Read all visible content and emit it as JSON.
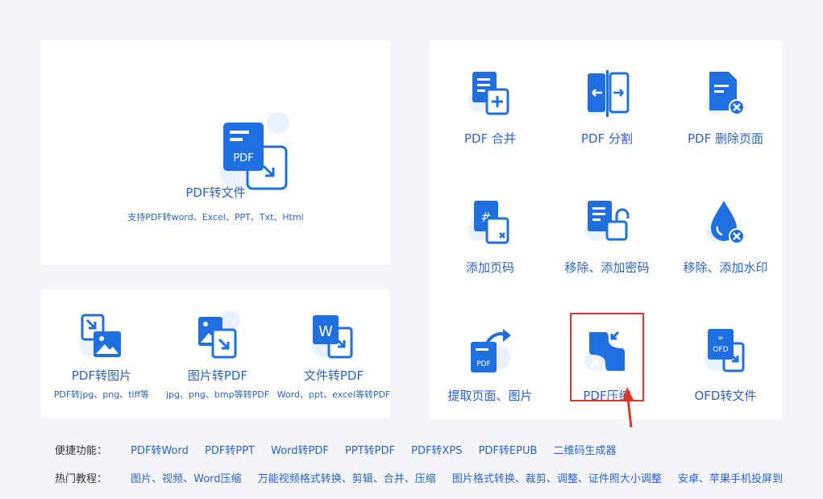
{
  "main_card": {
    "title": "PDF转文件",
    "subtitle": "支持PDF转word、Excel、PPT、Txt、Html",
    "icon": "pdf-to-file-icon",
    "icon_text": "PDF"
  },
  "conversions": [
    {
      "label": "PDF转图片",
      "desc": "PDF转jpg、png、tiff等",
      "icon": "pdf-to-image-icon"
    },
    {
      "label": "图片转PDF",
      "desc": "jpg、png、bmp等转PDF",
      "icon": "image-to-pdf-icon"
    },
    {
      "label": "文件转PDF",
      "desc": "Word、ppt、excel等转PDF",
      "icon": "file-to-pdf-icon",
      "icon_text": "W"
    }
  ],
  "tools": [
    {
      "label": "PDF 合并",
      "icon": "pdf-merge-icon"
    },
    {
      "label": "PDF 分割",
      "icon": "pdf-split-icon"
    },
    {
      "label": "PDF 删除页面",
      "icon": "pdf-delete-page-icon"
    },
    {
      "label": "添加页码",
      "icon": "add-page-number-icon"
    },
    {
      "label": "移除、添加密码",
      "icon": "password-icon"
    },
    {
      "label": "移除、添加水印",
      "icon": "watermark-icon"
    },
    {
      "label": "提取页面、图片",
      "icon": "extract-icon",
      "icon_text": "PDF"
    },
    {
      "label": "PDF压缩",
      "icon": "pdf-compress-icon"
    },
    {
      "label": "OFD转文件",
      "icon": "ofd-to-file-icon",
      "icon_text": "OFD"
    }
  ],
  "quick_bar": {
    "head": "便捷功能：",
    "links": [
      "PDF转Word",
      "PDF转PPT",
      "Word转PDF",
      "PPT转PDF",
      "PDF转XPS",
      "PDF转EPUB",
      "二维码生成器"
    ]
  },
  "hot_bar": {
    "head": "热门教程：",
    "links": [
      "图片、视频、Word压缩",
      "万能视频格式转换、剪辑、合并、压缩",
      "图片格式转换、裁剪、调整、证件照大小调整",
      "安卓、苹果手机投屏到"
    ]
  },
  "colors": {
    "accent": "#2c64c4",
    "icon_blue": "#1f6fe0",
    "highlight": "#e0342c"
  }
}
